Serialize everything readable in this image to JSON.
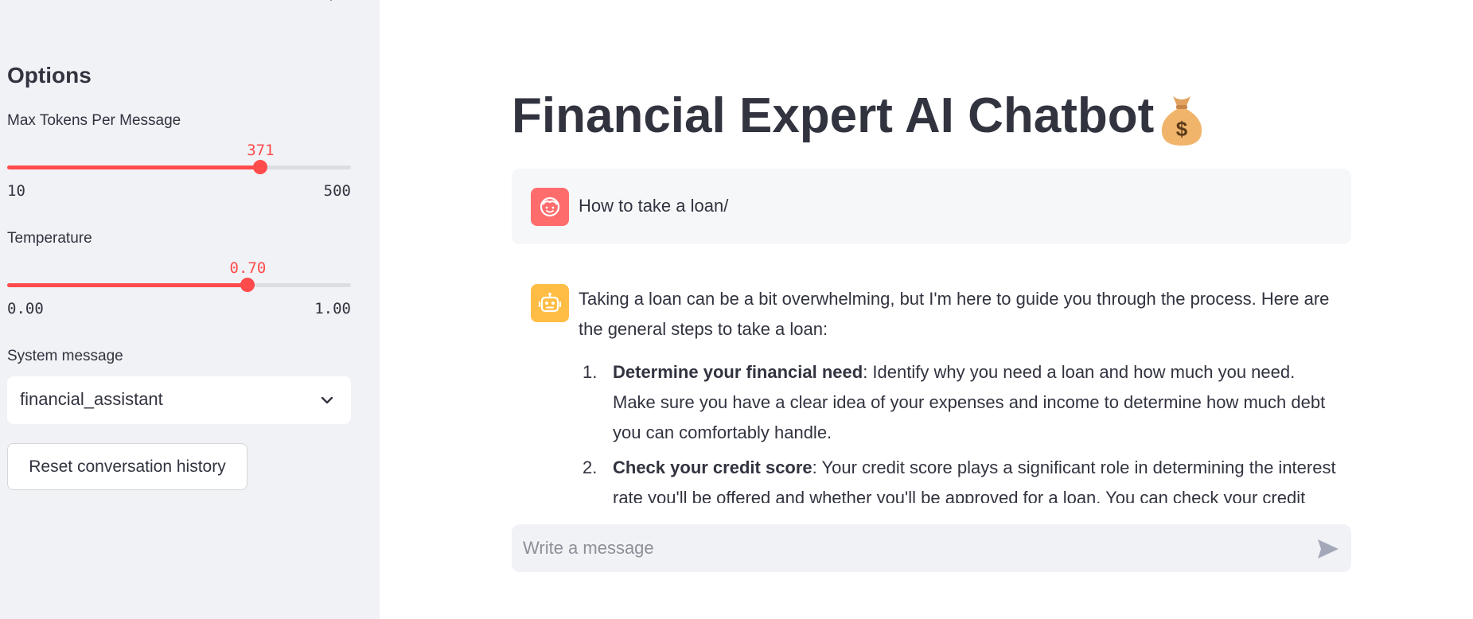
{
  "sidebar": {
    "heading": "Options",
    "max_tokens": {
      "label": "Max Tokens Per Message",
      "value": "371",
      "min": "10",
      "max": "500",
      "fraction": 0.737
    },
    "temperature": {
      "label": "Temperature",
      "value": "0.70",
      "min": "0.00",
      "max": "1.00",
      "fraction": 0.7
    },
    "system_message": {
      "label": "System message",
      "selected": "financial_assistant"
    },
    "reset_label": "Reset conversation history"
  },
  "main": {
    "title": "Financial Expert AI Chatbot",
    "title_icon": "money-bag-icon",
    "messages": [
      {
        "role": "user",
        "avatar": "user-face-icon",
        "text": "How to take a loan/"
      },
      {
        "role": "assistant",
        "avatar": "robot-icon",
        "intro": "Taking a loan can be a bit overwhelming, but I'm here to guide you through the process. Here are the general steps to take a loan:",
        "steps": [
          {
            "num": "1.",
            "title": "Determine your financial need",
            "text": ": Identify why you need a loan and how much you need. Make sure you have a clear idea of your expenses and income to determine how much debt you can comfortably handle."
          },
          {
            "num": "2.",
            "title": "Check your credit score",
            "text": ": Your credit score plays a significant role in determining the interest rate you'll be offered and whether you'll be approved for a loan. You can check your credit"
          }
        ]
      }
    ],
    "input": {
      "placeholder": "Write a message",
      "value": ""
    }
  },
  "colors": {
    "accent": "#ff4b4b",
    "sidebar_bg": "#f0f2f6",
    "user_avatar": "#ff6c6c",
    "bot_avatar": "#ffbd45"
  }
}
